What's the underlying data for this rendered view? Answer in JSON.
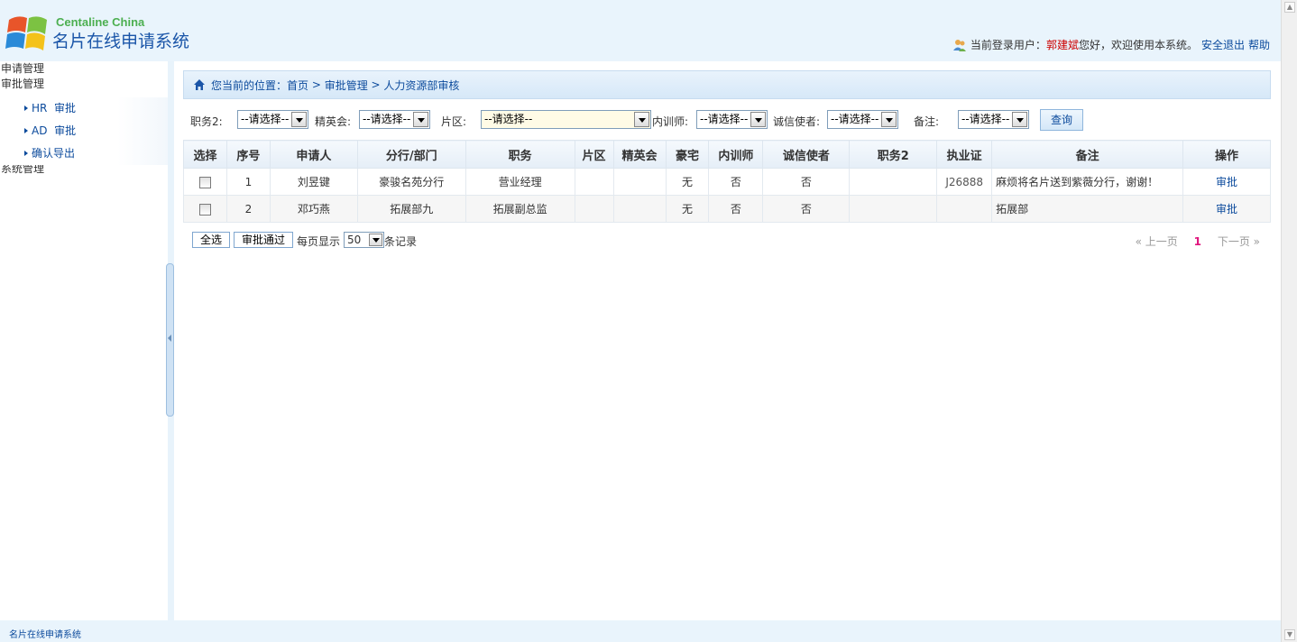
{
  "header": {
    "brand_en": "Centaline China",
    "brand_cn": "名片在线申请系统",
    "user_prefix": "当前登录用户：",
    "user_name": "郭建斌",
    "user_suffix": "您好，欢迎使用本系统。",
    "logout": "安全退出",
    "help": "帮助"
  },
  "sidebar": {
    "group1": "申请管理",
    "group2": "审批管理",
    "items": [
      {
        "label": "HR  审批"
      },
      {
        "label": "AD  审批"
      },
      {
        "label": "确认导出"
      }
    ],
    "group3": "系统管理"
  },
  "breadcrumb": {
    "prefix": "您当前的位置：",
    "home": "首页",
    "sep1": " > ",
    "level2": "审批管理",
    "sep2": " > ",
    "level3": "人力资源部审核"
  },
  "filters": {
    "zhiwu2_label": "职务2:",
    "zhiwu2_value": "--请选择--",
    "jingyinghui_label": "精英会:",
    "jingyinghui_value": "--请选择--",
    "pianqu_label": "片区:",
    "pianqu_value": "--请选择--",
    "neixunshi_label": "内训师:",
    "neixunshi_value": "--请选择--",
    "chengxin_label": "诚信使者:",
    "chengxin_value": "--请选择--",
    "beizhu_label": "备注:",
    "beizhu_value": "--请选择--",
    "query_button": "查询"
  },
  "table": {
    "columns": [
      "选择",
      "序号",
      "申请人",
      "分行/部门",
      "职务",
      "片区",
      "精英会",
      "豪宅",
      "内训师",
      "诚信使者",
      "职务2",
      "执业证",
      "备注",
      "操作"
    ],
    "rows": [
      {
        "no": "1",
        "applicant": "刘昱键",
        "branch": "豪骏名苑分行",
        "position": "营业经理",
        "area": "",
        "elite": "",
        "mansion": "无",
        "trainer": "否",
        "integrity": "否",
        "position2": "",
        "license": "J26888",
        "remark": "麻烦将名片送到紫薇分行，谢谢！",
        "action": "审批"
      },
      {
        "no": "2",
        "applicant": "邓巧燕",
        "branch": "拓展部九",
        "position": "拓展副总监",
        "area": "",
        "elite": "",
        "mansion": "无",
        "trainer": "否",
        "integrity": "否",
        "position2": "",
        "license": "",
        "remark": "拓展部",
        "action": "审批"
      }
    ]
  },
  "bottom": {
    "select_all": "全选",
    "approve": "审批通过",
    "per_page_label": "每页显示",
    "per_page_value": "50",
    "records_label": "条记录",
    "prev": "« 上一页",
    "current_page": "1",
    "next": "下一页 »"
  },
  "footer": {
    "text": "名片在线申请系统"
  }
}
